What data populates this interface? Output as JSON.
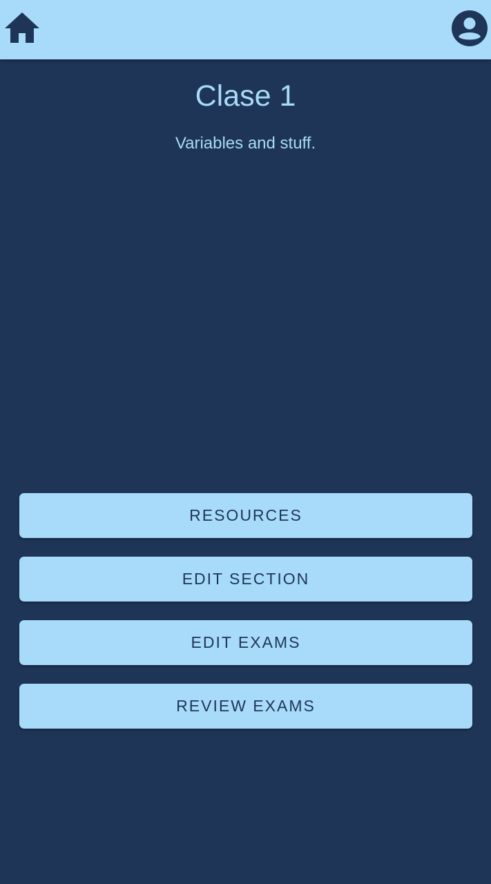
{
  "app_bar": {
    "home_icon": "home-icon",
    "account_icon": "account-circle-icon",
    "background_color": "#a8dbf9"
  },
  "section": {
    "title": "Clase 1",
    "description": "Variables and stuff."
  },
  "actions": {
    "resources_label": "RESOURCES",
    "edit_section_label": "EDIT SECTION",
    "edit_exams_label": "EDIT EXAMS",
    "review_exams_label": "REVIEW EXAMS"
  },
  "colors": {
    "background": "#1e3557",
    "accent": "#a8dbf9"
  }
}
